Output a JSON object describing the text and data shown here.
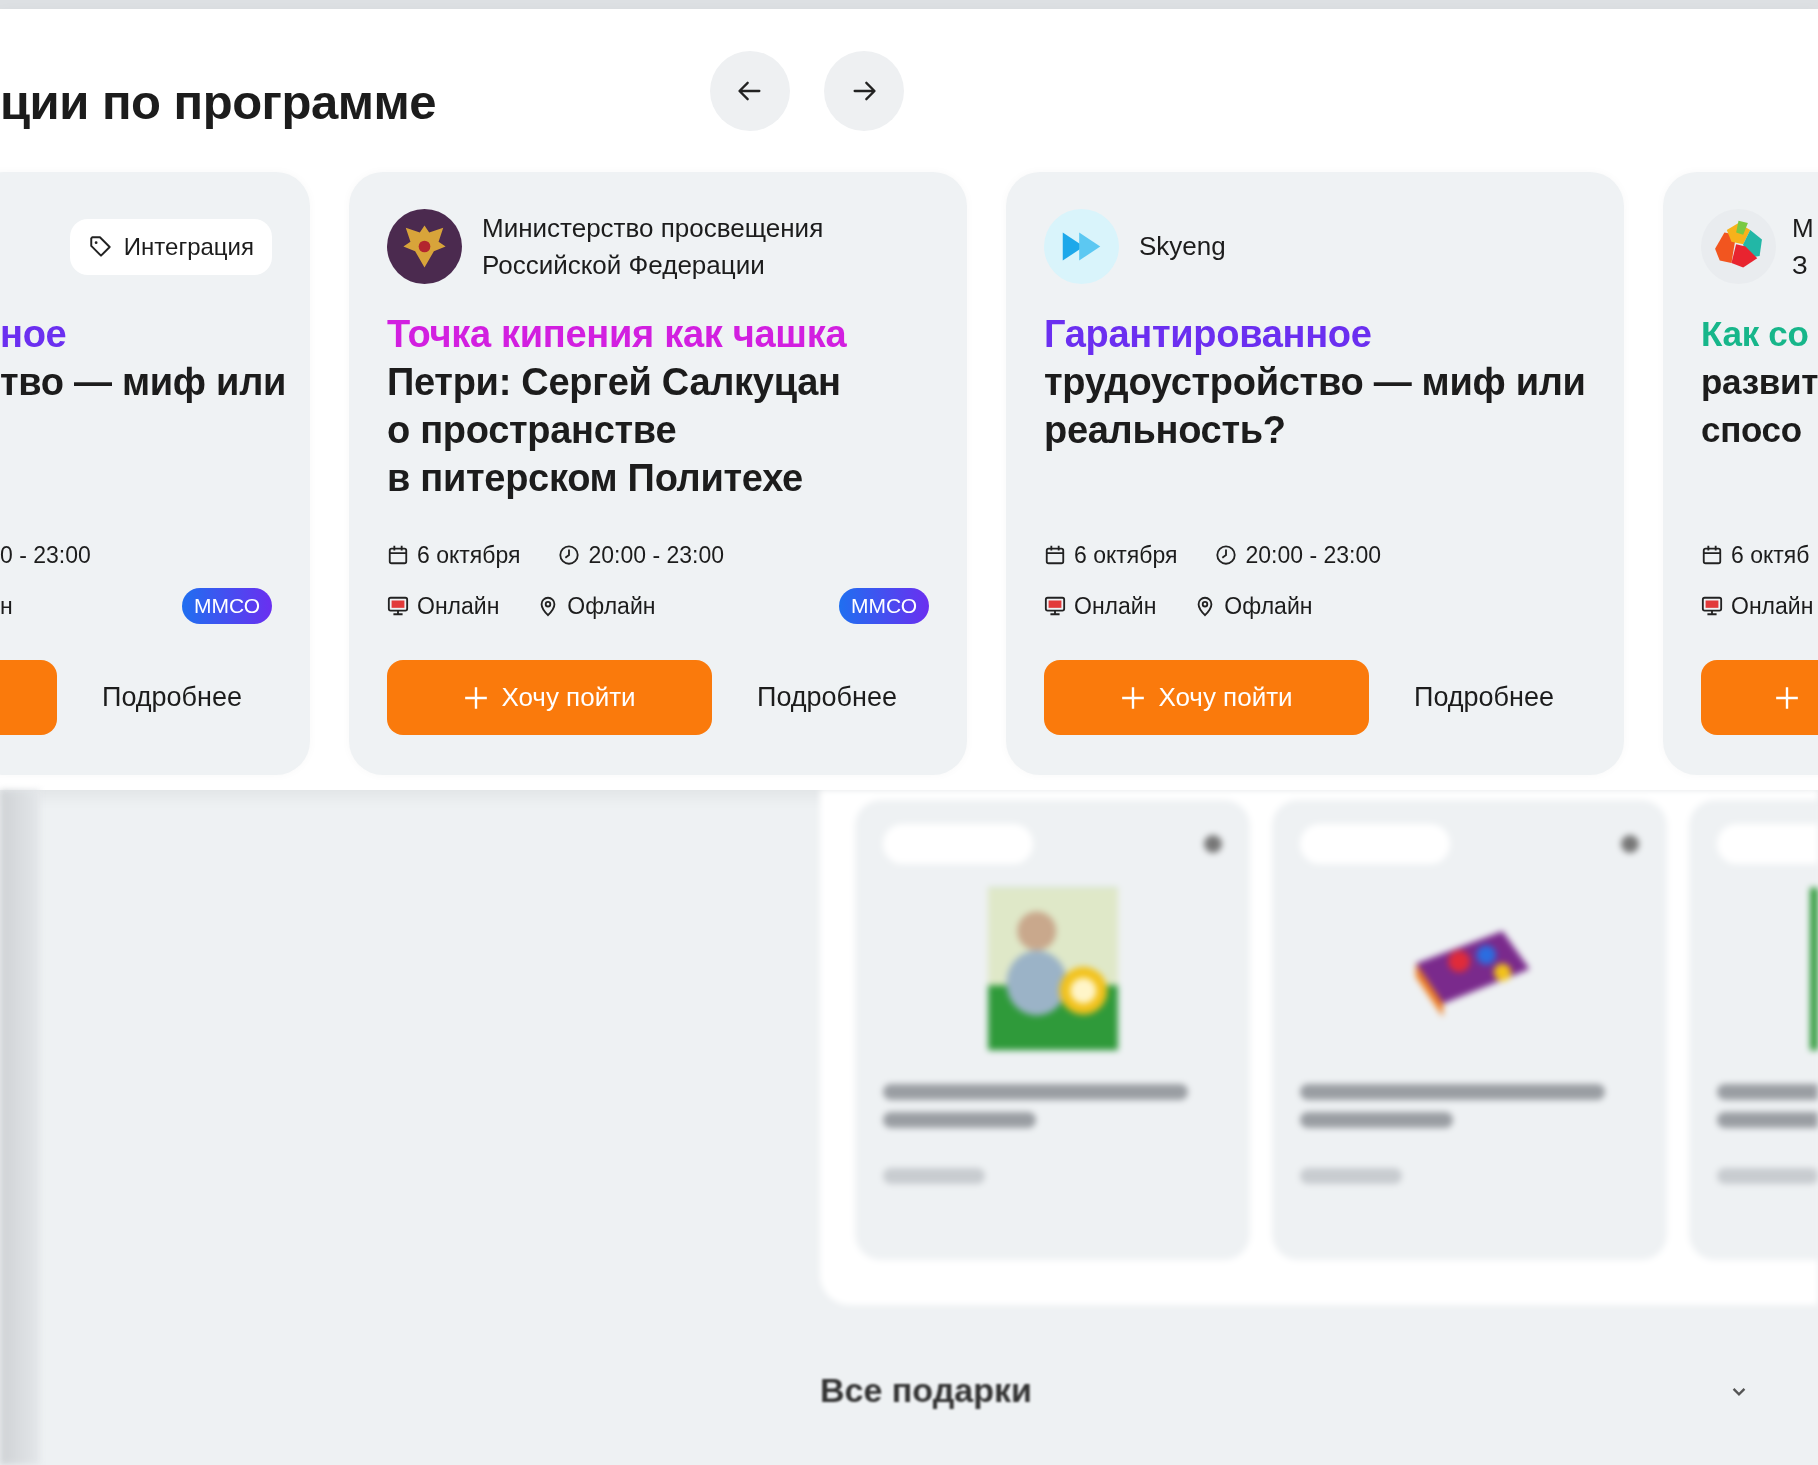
{
  "section_title": "ции по программе",
  "nav": [
    {
      "kind": "prev"
    },
    {
      "kind": "next"
    }
  ],
  "cards": [
    {
      "kind": "cut-left",
      "tag": "Интеграция",
      "title": {
        "accent": "ное",
        "color": "#6b2ff0",
        "lines": [
          "тво — миф или"
        ]
      },
      "meta": [
        [
          {
            "kind": "plain",
            "text": "0 - 23:00"
          }
        ],
        [
          {
            "kind": "plain",
            "text": "н"
          }
        ]
      ],
      "badge": "ММСО",
      "action": {
        "kind": "stub-left"
      },
      "more": "Подробнее"
    },
    {
      "kind": "full",
      "org": {
        "logo": {
          "kind": "emblem"
        },
        "lines": [
          "Министерство просвещения",
          "Российской Федерации"
        ]
      },
      "title": {
        "accent": "Точка кипения как чашка",
        "color": "#d21fe0",
        "lines": [
          "Петри: Сергей Салкуцан",
          "о пространстве",
          "в питерском Политехе"
        ]
      },
      "meta": [
        [
          {
            "kind": "date",
            "text": "6 октября"
          },
          {
            "kind": "time",
            "text": "20:00 - 23:00"
          }
        ],
        [
          {
            "kind": "online",
            "text": "Онлайн"
          },
          {
            "kind": "offline",
            "text": "Офлайн"
          }
        ]
      ],
      "badge": "ММСО",
      "action": {
        "kind": "full",
        "label": "Хочу пойти"
      },
      "more": "Подробнее"
    },
    {
      "kind": "full",
      "org": {
        "logo": {
          "kind": "skyeng"
        },
        "lines": [
          "Skyeng"
        ]
      },
      "title": {
        "accent": "Гарантированное",
        "color": "#6b2ff0",
        "lines": [
          "трудоустройство — миф или",
          "реальность?"
        ]
      },
      "meta": [
        [
          {
            "kind": "date",
            "text": "6 октября"
          },
          {
            "kind": "time",
            "text": "20:00 - 23:00"
          }
        ],
        [
          {
            "kind": "online",
            "text": "Онлайн"
          },
          {
            "kind": "offline",
            "text": "Офлайн"
          }
        ]
      ],
      "action": {
        "kind": "full",
        "label": "Хочу пойти"
      },
      "more": "Подробнее"
    },
    {
      "kind": "cut-right",
      "org": {
        "logo": {
          "kind": "petals"
        },
        "lines": [
          "М",
          "З"
        ]
      },
      "title": {
        "accent": "Как со",
        "color": "#17b68a",
        "lines": [
          "развит",
          "спосо"
        ]
      },
      "meta": [
        [
          {
            "kind": "date",
            "text": "6 октяб"
          }
        ],
        [
          {
            "kind": "online",
            "text": "Онлайн"
          }
        ]
      ],
      "action": {
        "kind": "stub-right"
      }
    }
  ],
  "gifts_heading": "Все подарки"
}
